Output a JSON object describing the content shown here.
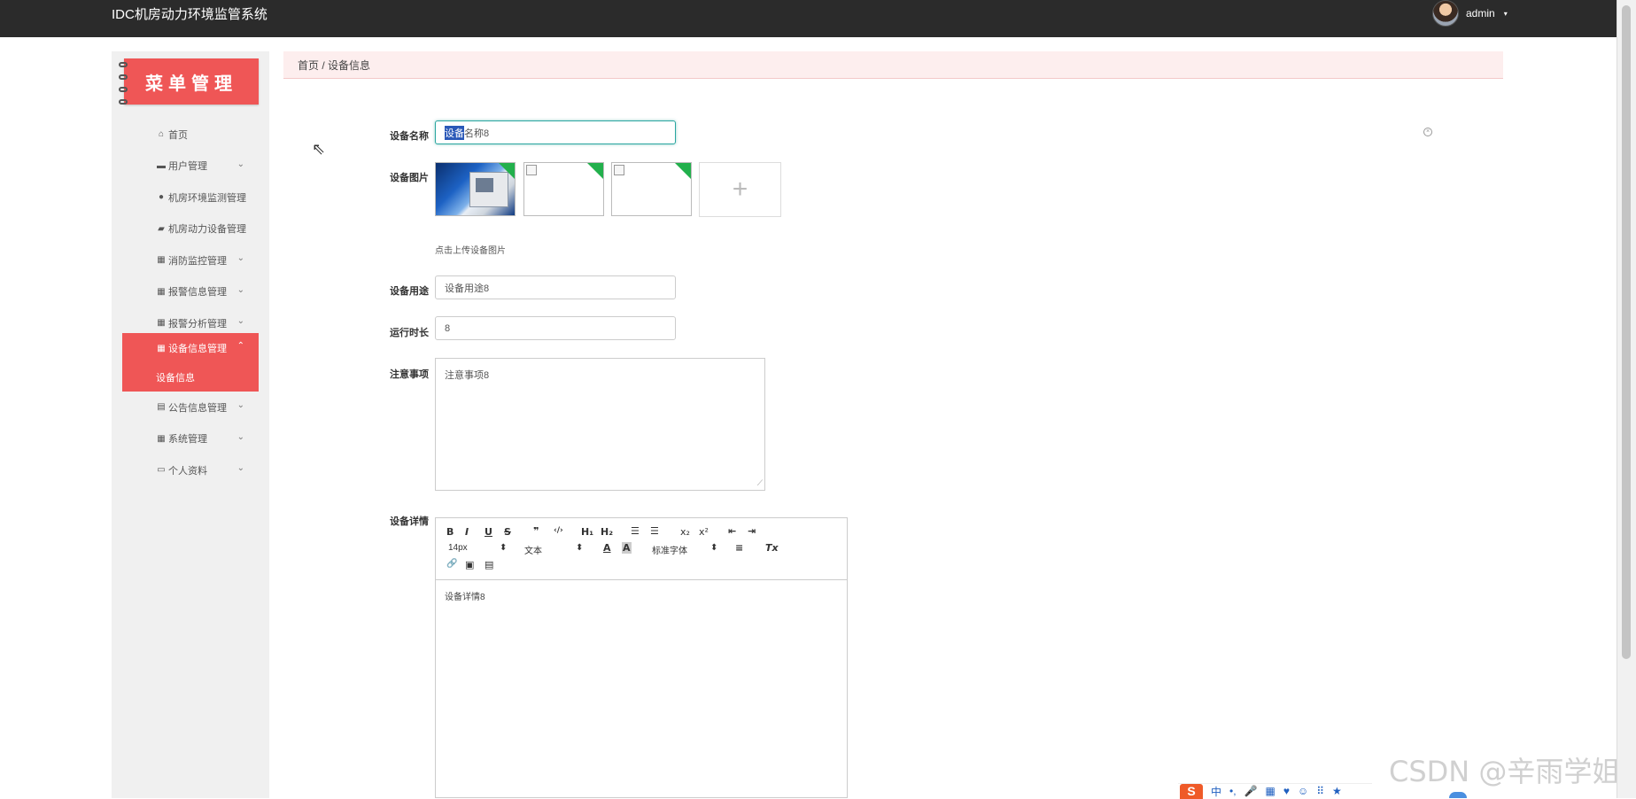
{
  "header": {
    "title": "IDC机房动力环境监管系统",
    "username": "admin",
    "caret": "▾"
  },
  "sidebar": {
    "menu_title": "菜单管理",
    "items": [
      {
        "label": "首页",
        "icon": "home-icon",
        "glyph": "⌂",
        "chevron": ""
      },
      {
        "label": "用户管理",
        "icon": "briefcase-icon",
        "glyph": "▬",
        "chevron": "⌄"
      },
      {
        "label": "机房环境监测管理",
        "icon": "user-icon",
        "glyph": "●",
        "chevron": ""
      },
      {
        "label": "机房动力设备管理",
        "icon": "comment-icon",
        "glyph": "▰",
        "chevron": ""
      },
      {
        "label": "消防监控管理",
        "icon": "grid-icon",
        "glyph": "▦",
        "chevron": "⌄"
      },
      {
        "label": "报警信息管理",
        "icon": "grid-icon",
        "glyph": "▦",
        "chevron": "⌄"
      },
      {
        "label": "报警分析管理",
        "icon": "grid-icon",
        "glyph": "▦",
        "chevron": "⌄"
      }
    ],
    "active_item": {
      "label": "设备信息管理",
      "icon": "grid-icon",
      "glyph": "▦",
      "chevron": "⌃",
      "sub_label": "设备信息"
    },
    "items_after": [
      {
        "label": "公告信息管理",
        "icon": "clipboard-icon",
        "glyph": "▤",
        "chevron": "⌄"
      },
      {
        "label": "系统管理",
        "icon": "grid-icon",
        "glyph": "▦",
        "chevron": "⌄"
      },
      {
        "label": "个人资料",
        "icon": "calendar-icon",
        "glyph": "▭",
        "chevron": "⌄"
      }
    ]
  },
  "breadcrumb": "首页 / 设备信息",
  "form": {
    "name_label": "设备名称",
    "name_selected": "设备",
    "name_rest": "名称8",
    "image_label": "设备图片",
    "upload_plus": "+",
    "upload_hint": "点击上传设备图片",
    "usage_label": "设备用途",
    "usage_value": "设备用途8",
    "runtime_label": "运行时长",
    "runtime_value": "8",
    "notes_label": "注意事项",
    "notes_value": "注意事项8",
    "detail_label": "设备详情",
    "detail_value": "设备详情8"
  },
  "editor_toolbar": {
    "bold": "B",
    "italic": "I",
    "underline": "U",
    "strike": "S",
    "quote": "❞",
    "code": "‹/›",
    "h1": "H₁",
    "h2": "H₂",
    "ordered_list": "☰",
    "bullet_list": "☰",
    "subscript": "x₂",
    "superscript": "x²",
    "indent_out": "⇤",
    "indent_in": "⇥",
    "font_size": "14px",
    "text_type": "文本",
    "font_family": "标准字体",
    "color": "A",
    "background": "A",
    "align": "≡",
    "clear": "Tx",
    "link": "🔗",
    "image": "▣",
    "video": "▤",
    "select_arrows": "⬍"
  },
  "clear_icon_glyph": "×",
  "resize_glyph": "⟋",
  "watermark": "CSDN @辛雨学姐",
  "ime": {
    "logo": "S",
    "mode": "中",
    "symbols": [
      "•,",
      "🎤",
      "▦",
      "♥",
      "☺",
      "⠿",
      "★"
    ]
  }
}
